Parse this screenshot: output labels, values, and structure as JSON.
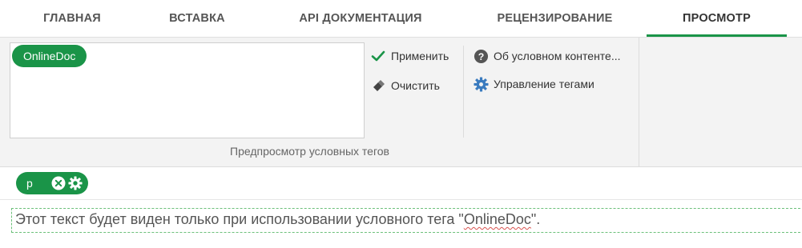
{
  "tabs": [
    {
      "label": "ГЛАВНАЯ"
    },
    {
      "label": "ВСТАВКА"
    },
    {
      "label": "API ДОКУМЕНТАЦИЯ"
    },
    {
      "label": "РЕЦЕНЗИРОВАНИЕ"
    },
    {
      "label": "ПРОСМОТР"
    }
  ],
  "ribbon": {
    "preview_tags": [
      {
        "label": "OnlineDoc"
      }
    ],
    "apply_label": "Применить",
    "clear_label": "Очистить",
    "about_label": "Об условном контенте...",
    "manage_label": "Управление тегами",
    "group_label": "Предпросмотр условных тегов"
  },
  "tag_chip": {
    "label": "p"
  },
  "content": {
    "text_before": "Этот текст будет виден только при использовании условного тега \"",
    "tag_word": "OnlineDoc",
    "text_after": "\"."
  },
  "colors": {
    "accent": "#1a9448",
    "dashed_border": "#6cc07a"
  },
  "icons": [
    "check-icon",
    "eraser-icon",
    "help-circle-icon",
    "gear-icon",
    "close-circle-icon",
    "settings-icon"
  ]
}
